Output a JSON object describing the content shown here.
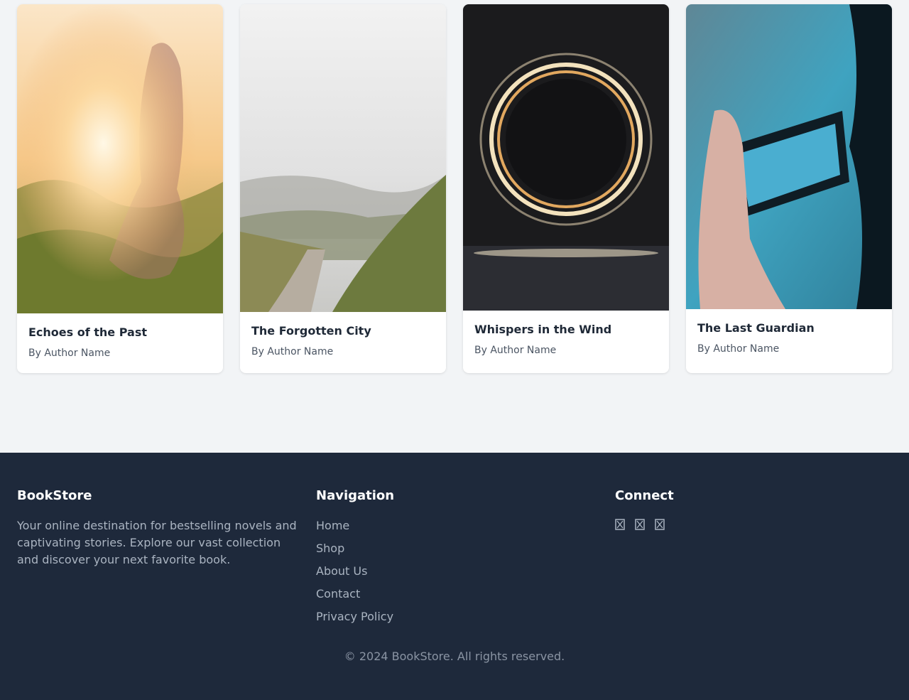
{
  "books": [
    {
      "title": "Echoes of the Past",
      "author": "By Author Name",
      "cover": "sunlit-girl-in-meadow-photo"
    },
    {
      "title": "The Forgotten City",
      "author": "By Author Name",
      "cover": "misty-mountain-trail-photo"
    },
    {
      "title": "Whispers in the Wind",
      "author": "By Author Name",
      "cover": "steel-wool-light-ring-photo"
    },
    {
      "title": "The Last Guardian",
      "author": "By Author Name",
      "cover": "hand-holding-phone-photo"
    }
  ],
  "footer": {
    "brand": {
      "heading": "BookStore",
      "description": "Your online destination for bestselling novels and captivating stories. Explore our vast collection and discover your next favorite book."
    },
    "navigation": {
      "heading": "Navigation",
      "links": [
        "Home",
        "Shop",
        "About Us",
        "Contact",
        "Privacy Policy"
      ]
    },
    "connect": {
      "heading": "Connect",
      "icons": [
        "social-icon-1",
        "social-icon-2",
        "social-icon-3"
      ]
    },
    "copyright": "© 2024 BookStore. All rights reserved."
  },
  "colors": {
    "page_background": "#f2f4f6",
    "footer_background": "#1e293b",
    "title_text": "#1f2937",
    "muted_text": "#aab4c1"
  }
}
